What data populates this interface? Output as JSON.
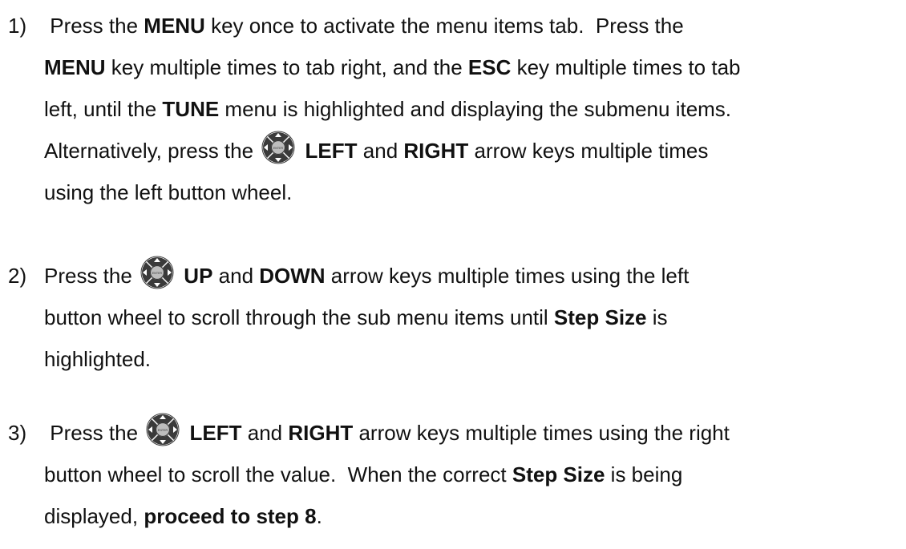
{
  "icon": {
    "name": "enter-button-wheel-icon",
    "center_label": "ENTER",
    "color": "#3a3a3a"
  },
  "steps": [
    {
      "number": "1)",
      "lines": [
        [
          {
            "t": " Press the "
          },
          {
            "b": "MENU"
          },
          {
            "t": " key once to activate the menu items tab.  Press the"
          }
        ],
        [
          {
            "b": "MENU"
          },
          {
            "t": " key multiple times to tab right, and the "
          },
          {
            "b": "ESC"
          },
          {
            "t": " key multiple times to tab"
          }
        ],
        [
          {
            "t": "left, until the "
          },
          {
            "b": "TUNE"
          },
          {
            "t": " menu is highlighted and displaying the submenu items."
          }
        ],
        [
          {
            "t": "Alternatively, press the "
          },
          {
            "icon": true
          },
          {
            "t": " "
          },
          {
            "b": "LEFT"
          },
          {
            "t": " and "
          },
          {
            "b": "RIGHT"
          },
          {
            "t": " arrow keys multiple times"
          }
        ],
        [
          {
            "t": "using the left button wheel."
          }
        ]
      ]
    },
    {
      "number": "2)",
      "lines": [
        [
          {
            "t": "Press the "
          },
          {
            "icon": true
          },
          {
            "t": " "
          },
          {
            "b": "UP"
          },
          {
            "t": " and "
          },
          {
            "b": "DOWN"
          },
          {
            "t": " arrow keys multiple times using the left"
          }
        ],
        [
          {
            "t": "button wheel to scroll through the sub menu items until "
          },
          {
            "b": "Step Size"
          },
          {
            "t": " is"
          }
        ],
        [
          {
            "t": "highlighted."
          }
        ]
      ]
    },
    {
      "number": "3)",
      "lines": [
        [
          {
            "t": " Press the "
          },
          {
            "icon": true
          },
          {
            "t": " "
          },
          {
            "b": "LEFT"
          },
          {
            "t": " and "
          },
          {
            "b": "RIGHT"
          },
          {
            "t": " arrow keys multiple times using the right"
          }
        ],
        [
          {
            "t": "button wheel to scroll the value.  When the correct "
          },
          {
            "b": "Step Size"
          },
          {
            "t": " is being"
          }
        ],
        [
          {
            "t": "displayed, "
          },
          {
            "b": "proceed to step 8"
          },
          {
            "t": "."
          }
        ]
      ]
    }
  ]
}
